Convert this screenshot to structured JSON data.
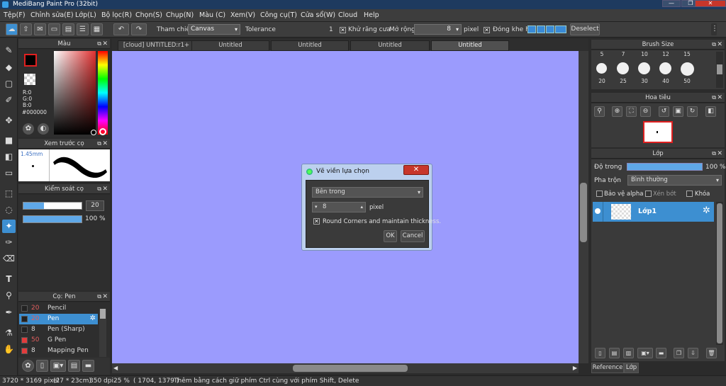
{
  "window": {
    "title": "MediBang Paint Pro (32bit)"
  },
  "menu": [
    "Tệp(F)",
    "Chỉnh sửa(E)",
    "Lớp(L)",
    "Bộ lọc(R)",
    "Chọn(S)",
    "Chụp(N)",
    "Màu (C)",
    "Xem(V)",
    "Công cụ(T)",
    "Cửa sổ(W)",
    "Cloud",
    "Help"
  ],
  "toolbar": {
    "reference_label": "Tham chiếu",
    "reference_value": "Canvas",
    "tolerance_label": "Tolerance",
    "tolerance_value": "1",
    "antialias_label": "Khử răng cưa",
    "expand_label": "Mở rộng",
    "expand_value": "8",
    "expand_unit": "pixel",
    "close_gap_label": "Đóng khe hở",
    "deselect_label": "Deselect",
    "tolerance_percent": 0.03
  },
  "color_panel": {
    "title": "Màu",
    "r": "R:0",
    "g": "G:0",
    "b": "B:0",
    "hex": "#000000",
    "primary_color": "#000000"
  },
  "preview_panel": {
    "title": "Xem trước cọ",
    "size": "1.45mm"
  },
  "brush_control": {
    "title": "Kiểm soát cọ",
    "size_value": "20",
    "opacity_value": "100 %",
    "size_fraction": 0.35,
    "opacity_fraction": 1.0
  },
  "brush_list": {
    "title": "Cọ: Pen",
    "items": [
      {
        "size": "20",
        "name": "Pencil",
        "color": "#222222"
      },
      {
        "size": "20",
        "name": "Pen",
        "color": "#222222"
      },
      {
        "size": "8",
        "name": "Pen (Sharp)",
        "color": "#222222"
      },
      {
        "size": "50",
        "name": "G Pen",
        "color": "#e23c3c"
      },
      {
        "size": "8",
        "name": "Mapping Pen",
        "color": "#e23c3c"
      }
    ]
  },
  "tabs": [
    "[cloud] UNTITLED:r1+",
    "Untitled",
    "Untitled",
    "Untitled",
    "Untitled"
  ],
  "dialog": {
    "title": "Vẽ viền lựa chọn",
    "position_value": "Bên trong",
    "width_value": "8",
    "width_unit": "pixel",
    "round_corners_label": "Round Corners and maintain thickness.",
    "ok_label": "OK",
    "cancel_label": "Cancel"
  },
  "brush_size_panel": {
    "title": "Brush Size",
    "top_labels": [
      "5",
      "7",
      "10",
      "12",
      "15"
    ],
    "bottom_labels": [
      "20",
      "25",
      "30",
      "40",
      "50"
    ]
  },
  "navigator": {
    "title": "Hoa tiêu"
  },
  "layer_panel": {
    "title": "Lớp",
    "opacity_label": "Độ trong",
    "opacity_value": "100 %",
    "blend_label": "Pha trộn",
    "blend_value": "Bình thường",
    "protect_alpha_label": "Bảo vệ alpha",
    "clipping_label": "Xén bớt",
    "lock_label": "Khóa",
    "layer_name": "Lớp1",
    "bottom_tabs": [
      "Reference",
      "Lớp"
    ]
  },
  "status": {
    "size": "3720 * 3169 pixel",
    "cm": "(27 * 23cm)",
    "dpi": "350 dpi",
    "zoom": "25 %",
    "coords": "( 1704, 1379 )",
    "hint": "Thêm bằng cách giữ phím Ctrl cùng với phím Shift, Delete"
  }
}
